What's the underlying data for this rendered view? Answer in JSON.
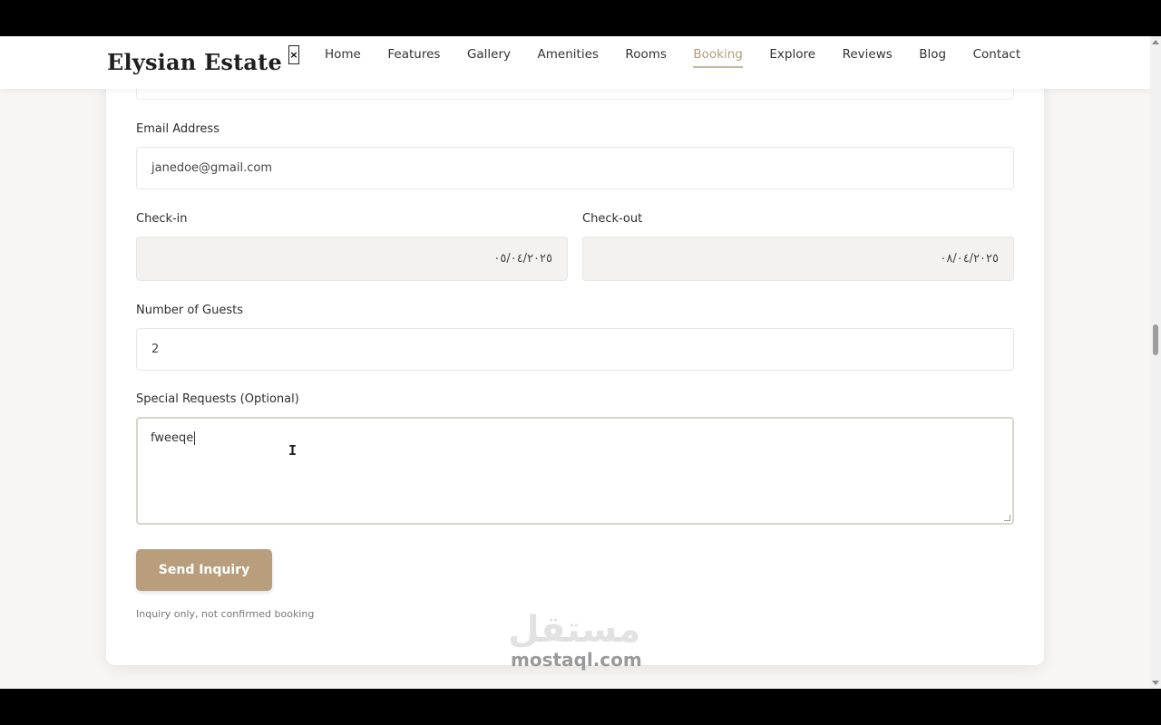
{
  "header": {
    "logo": "Elysian Estate",
    "close_glyph": "×",
    "nav": [
      "Home",
      "Features",
      "Gallery",
      "Amenities",
      "Rooms",
      "Booking",
      "Explore",
      "Reviews",
      "Blog",
      "Contact"
    ],
    "active_nav": "Booking"
  },
  "form": {
    "email_label": "Email Address",
    "email_value": "janedoe@gmail.com",
    "checkin_label": "Check-in",
    "checkin_value": "٠٥/٠٤/٢٠٢٥",
    "checkout_label": "Check-out",
    "checkout_value": "٠٨/٠٤/٢٠٢٥",
    "guests_label": "Number of Guests",
    "guests_value": "2",
    "requests_label": "Special Requests (Optional)",
    "requests_value": "fweeqe",
    "submit_label": "Send Inquiry",
    "note": "Inquiry only, not confirmed booking"
  },
  "watermark": {
    "arabic": "مستقل",
    "latin": "mostaql.com"
  },
  "colors": {
    "accent": "#b89e7d",
    "active_nav": "#b49c7e"
  }
}
